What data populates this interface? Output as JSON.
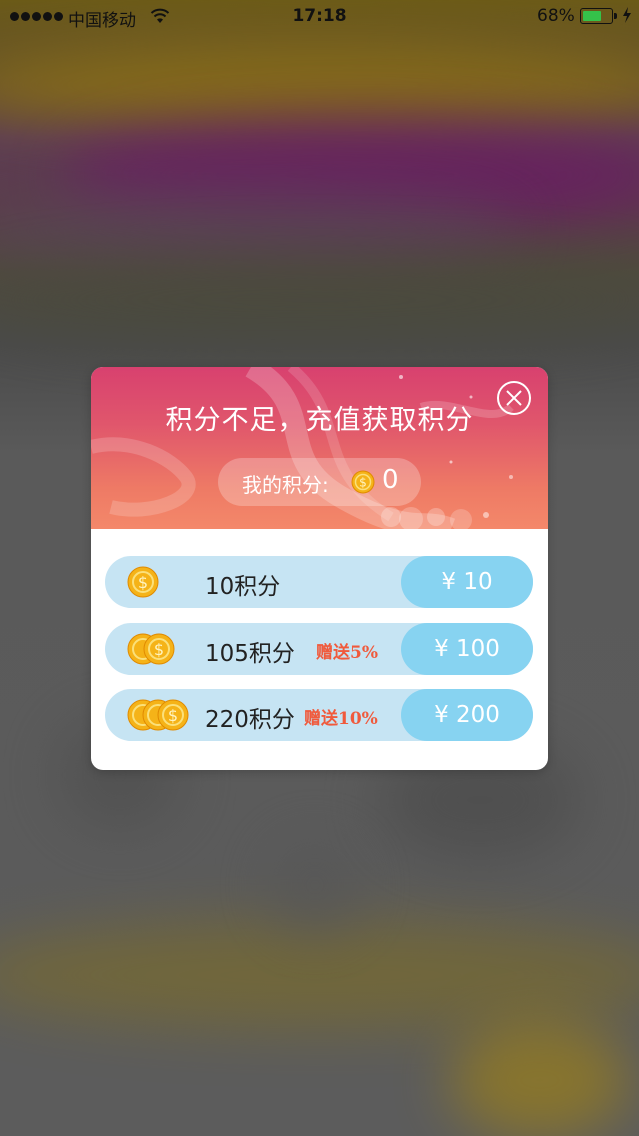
{
  "status_bar": {
    "carrier": "中国移动",
    "time": "17:18",
    "battery_percent": "68%",
    "battery_level": 0.68
  },
  "modal": {
    "title": "积分不足，充值获取积分",
    "my_points_label": "我的积分:",
    "my_points_value": "0",
    "packages": [
      {
        "points": "10积分",
        "bonus": "",
        "price": "¥ 10",
        "coin_count": 1
      },
      {
        "points": "105积分",
        "bonus": "赠送5%",
        "price": "¥ 100",
        "coin_count": 2
      },
      {
        "points": "220积分",
        "bonus": "赠送10%",
        "price": "¥ 200",
        "coin_count": 3
      }
    ]
  },
  "colors": {
    "header_top": "#d8416f",
    "header_bottom": "#f4886a",
    "package_bg": "#c6e4f3",
    "price_button": "#87d3f1",
    "bonus_text": "#f05a3c",
    "coin": "#f5b318"
  },
  "icons": [
    "signal-dots-icon",
    "wifi-icon",
    "battery-icon",
    "charging-bolt-icon",
    "close-icon",
    "coin-icon"
  ]
}
